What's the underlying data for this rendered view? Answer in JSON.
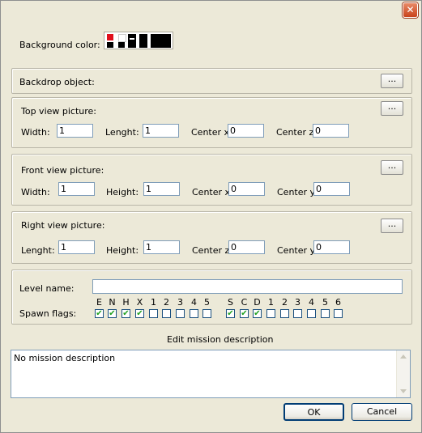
{
  "window": {
    "close_label": "✕"
  },
  "background": {
    "label": "Background color:"
  },
  "backdrop": {
    "label": "Backdrop object:",
    "browse": "..."
  },
  "top_view": {
    "title": "Top view picture:",
    "browse": "...",
    "width_label": "Width:",
    "width": "1",
    "length_label": "Lenght:",
    "length": "1",
    "cx_label": "Center x:",
    "cx": "0",
    "cz_label": "Center z:",
    "cz": "0"
  },
  "front_view": {
    "title": "Front view picture:",
    "browse": "...",
    "width_label": "Width:",
    "width": "1",
    "height_label": "Height:",
    "height": "1",
    "cx_label": "Center x:",
    "cx": "0",
    "cy_label": "Center y:",
    "cy": "0"
  },
  "right_view": {
    "title": "Right view picture:",
    "browse": "...",
    "length_label": "Lenght:",
    "length": "1",
    "height_label": "Height:",
    "height": "1",
    "cz_label": "Center z:",
    "cz": "0",
    "cy_label": "Center y:",
    "cy": "0"
  },
  "level": {
    "name_label": "Level name:",
    "name": "",
    "spawn_label": "Spawn flags:"
  },
  "spawn_flags": {
    "group1": [
      {
        "label": "E",
        "checked": true
      },
      {
        "label": "N",
        "checked": true
      },
      {
        "label": "H",
        "checked": true
      },
      {
        "label": "X",
        "checked": true
      },
      {
        "label": "1",
        "checked": false
      },
      {
        "label": "2",
        "checked": false
      },
      {
        "label": "3",
        "checked": false
      },
      {
        "label": "4",
        "checked": false
      },
      {
        "label": "5",
        "checked": false
      }
    ],
    "group2": [
      {
        "label": "S",
        "checked": true
      },
      {
        "label": "C",
        "checked": true
      },
      {
        "label": "D",
        "checked": true
      },
      {
        "label": "1",
        "checked": false
      },
      {
        "label": "2",
        "checked": false
      },
      {
        "label": "3",
        "checked": false
      },
      {
        "label": "4",
        "checked": false
      },
      {
        "label": "5",
        "checked": false
      },
      {
        "label": "6",
        "checked": false
      }
    ]
  },
  "mission": {
    "title": "Edit mission description",
    "text": "No mission description"
  },
  "buttons": {
    "ok": "OK",
    "cancel": "Cancel"
  },
  "colors": {
    "swatch_red": "#e0101c",
    "swatch_dark": "#000000",
    "close_red": "#c8431c"
  },
  "icons": {
    "close": "close-icon",
    "scroll_up": "arrow-up-icon",
    "scroll_down": "arrow-down-icon"
  }
}
